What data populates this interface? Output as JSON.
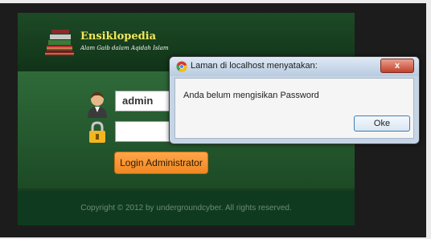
{
  "app": {
    "logo_title": "Ensiklopedia",
    "logo_subtitle": "Alam Gaib dalam Aqidah Islam",
    "icons": {
      "logo": "books-icon",
      "user": "user-avatar-icon",
      "password": "padlock-icon"
    }
  },
  "login_form": {
    "username_value": "admin",
    "password_value": "",
    "submit_label": "Login Administrator",
    "submit_color": "#f59a34"
  },
  "footer": {
    "copyright": "Copyright © 2012 by undergroundcyber. All rights reserved."
  },
  "alert_dialog": {
    "title": "Laman di localhost menyatakan:",
    "message": "Anda belum mengisikan Password",
    "ok_label": "Oke",
    "close_label": "x",
    "icons": {
      "browser": "chrome-icon",
      "close": "close-icon"
    }
  },
  "colors": {
    "panel_green": "#173d1f",
    "footer_green": "#0f3a1f",
    "logo_yellow": "#f0e85a",
    "dialog_frame": "#c6d5e6"
  }
}
